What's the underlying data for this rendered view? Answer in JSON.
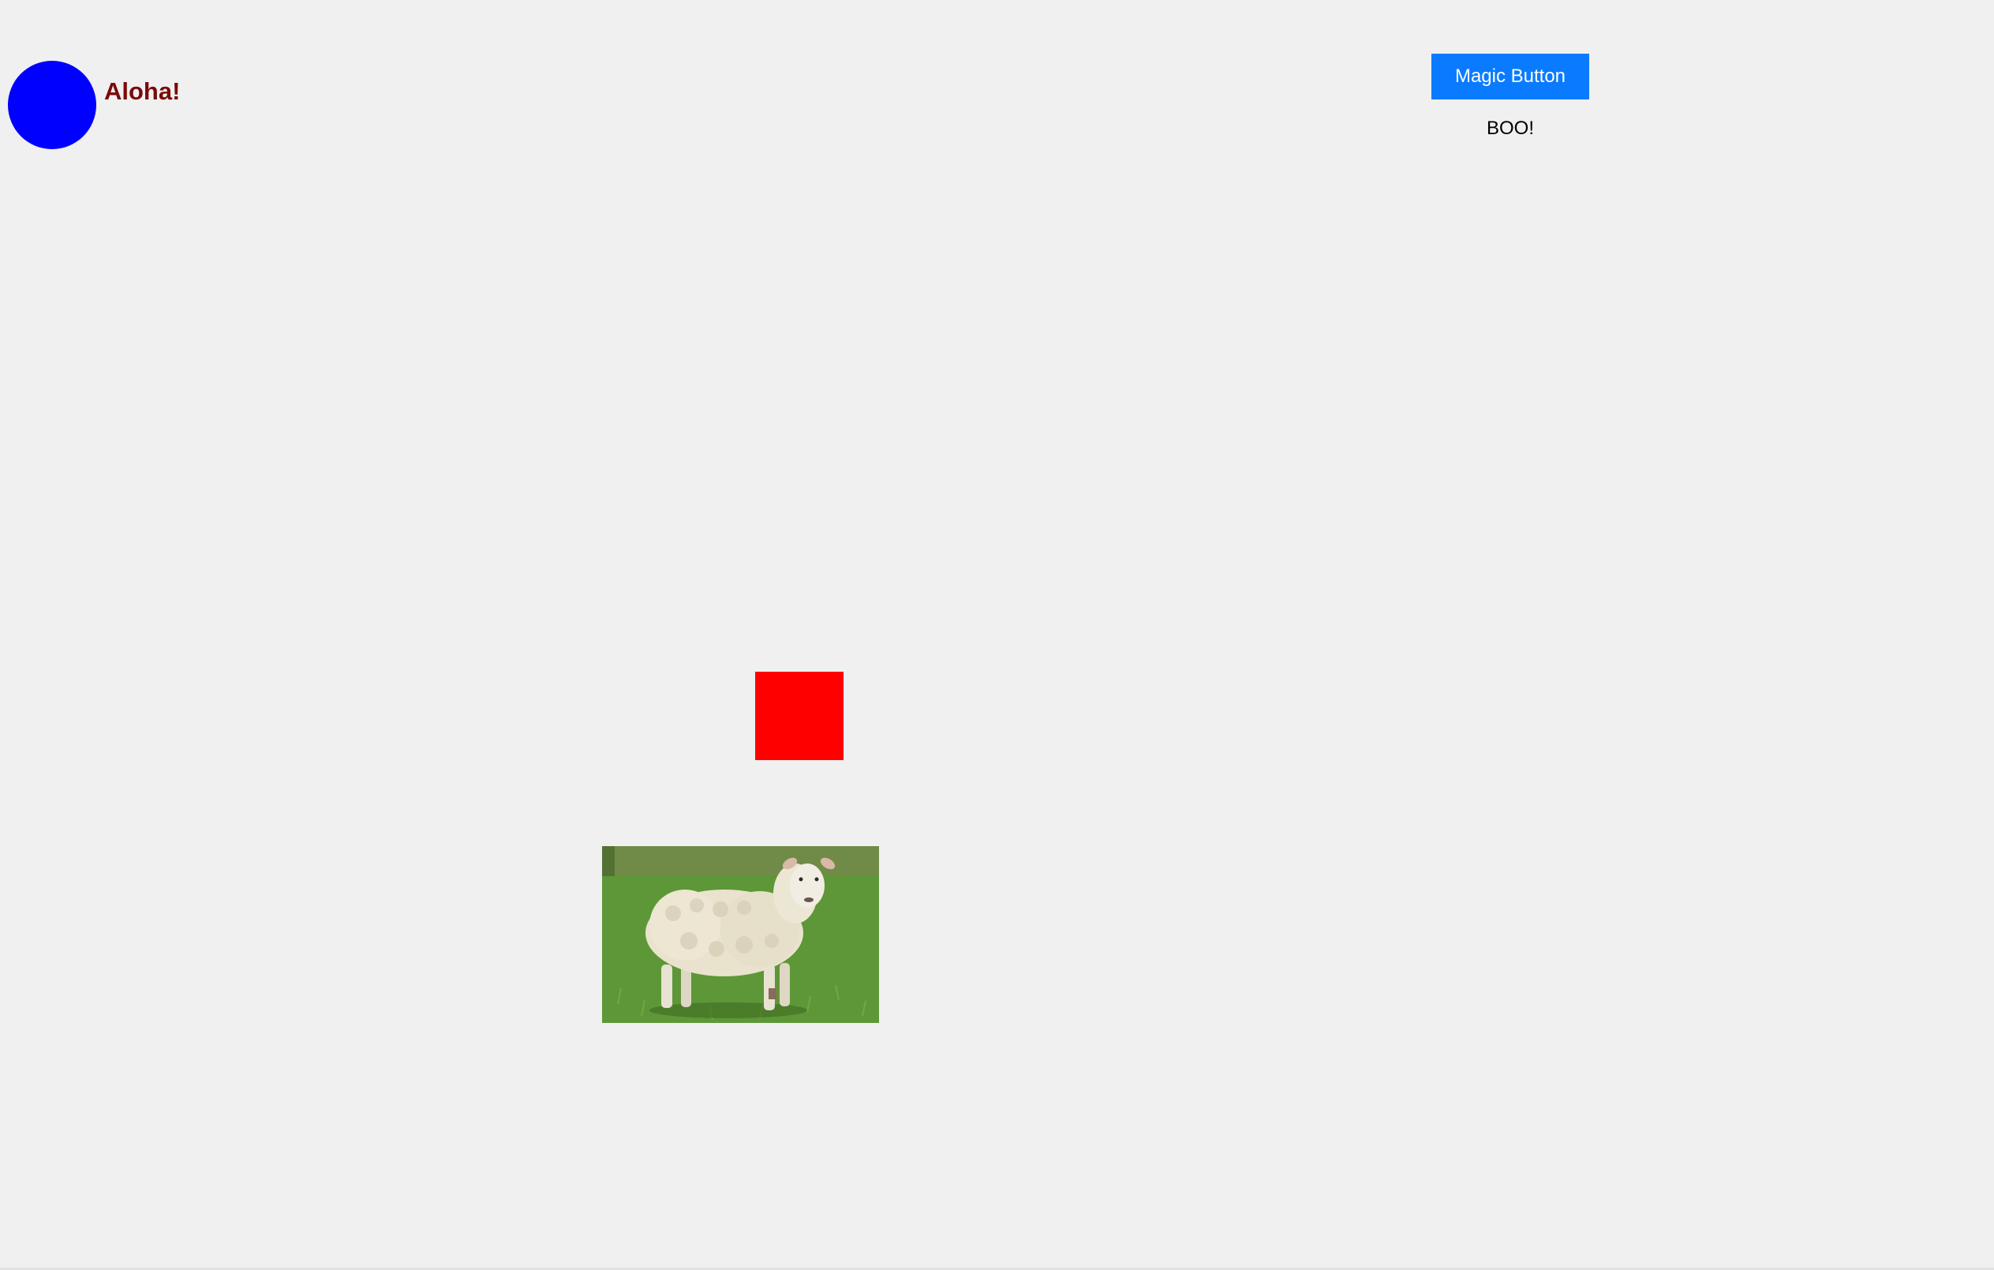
{
  "header": {
    "greeting": "Aloha!",
    "greeting_color": "#7a0a0a",
    "circle_color": "#0000ff"
  },
  "magic": {
    "button_label": "Magic Button",
    "button_color": "#0a7bff",
    "message": "BOO!"
  },
  "shapes": {
    "square_color": "#ff0000"
  },
  "image": {
    "subject": "sheep-photo"
  }
}
